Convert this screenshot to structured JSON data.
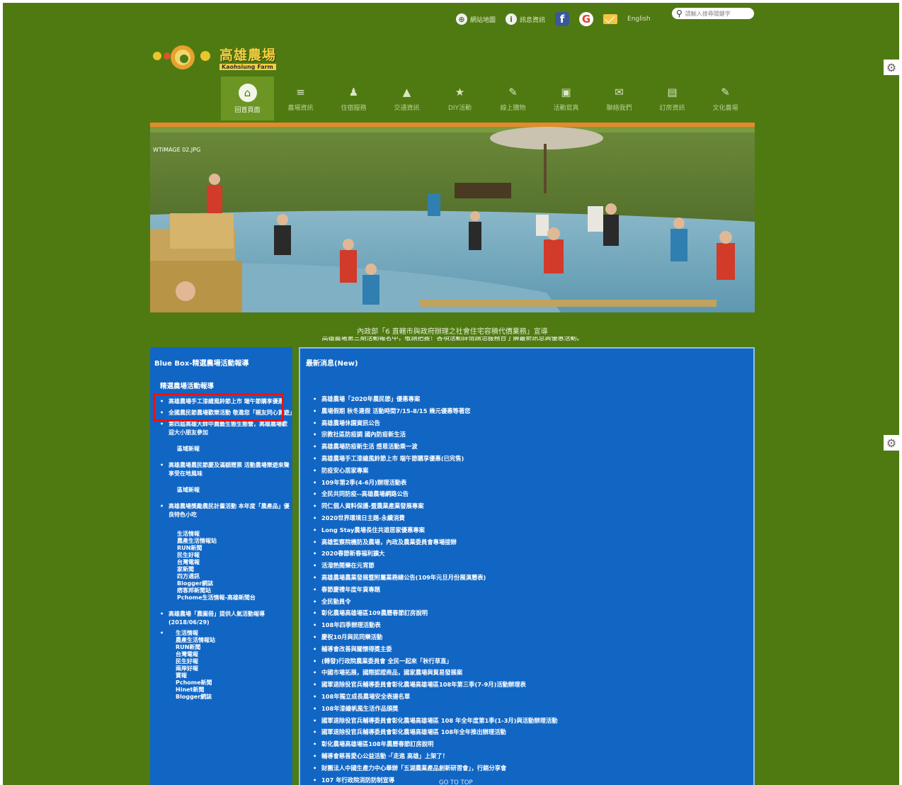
{
  "utility_bar": {
    "items": [
      {
        "icon": "sitemap-icon",
        "label": "網站地圖"
      },
      {
        "icon": "info-icon",
        "label": "訊息資訊"
      }
    ],
    "lang_label": "English",
    "search_placeholder": "請輸入搜尋關鍵字"
  },
  "logo": {
    "name_cn": "高雄農場",
    "name_en": "Kaohsiung Farm"
  },
  "nav": {
    "items": [
      {
        "label": "回首頁面",
        "icon": "home-icon",
        "glyph": "⌂"
      },
      {
        "label": "農場資訊",
        "icon": "list-icon",
        "glyph": "≡"
      },
      {
        "label": "住宿服務",
        "icon": "person-icon",
        "glyph": "♟"
      },
      {
        "label": "交通資訊",
        "icon": "mountain-icon",
        "glyph": "▲"
      },
      {
        "label": "DIY活動",
        "icon": "star-icon",
        "glyph": "★"
      },
      {
        "label": "線上購物",
        "icon": "edit-icon",
        "glyph": "✎"
      },
      {
        "label": "活動寫真",
        "icon": "image-icon",
        "glyph": "▣"
      },
      {
        "label": "聯絡我們",
        "icon": "mail-icon",
        "glyph": "✉"
      },
      {
        "label": "訂房資訊",
        "icon": "calendar-icon",
        "glyph": "▤"
      },
      {
        "label": "文化農場",
        "icon": "pencil-icon",
        "glyph": "✎"
      }
    ]
  },
  "banner": {
    "label": "WTIMAGE 02.JPG"
  },
  "marquee": {
    "text": "內政部「6 直轄市與政府辦理之社會住宅容積代價業務」宣導",
    "text2": "高雄農場第三期活動報名中，敬請把握！各項活動詳情請洽服務台了解最新訊息與優惠活動。"
  },
  "sidebar": {
    "title": "Blue Box-精選農場活動報導",
    "subtitle": "精選農場活動報導",
    "items": [
      "高雄農場手工漆繪風鈴節上市 端午節購享優惠",
      "全國農民節農場歡樂活動 敬邀您「親友同心賞遊」",
      "第四屆高雄大師中農藝生態生態營，高雄農場歡迎大小朋友參加",
      "區域新報",
      "高雄農場農民節慶及滿額贈票 活動農場樂遊來聲享受在地風味",
      "區域新報",
      "高雄農場獎勵農民計畫活動 本年度「農產品」優良特色小吃"
    ],
    "plain_block_1": [
      "生活情報",
      "農產生活情報站",
      "RUN新聞",
      "民生好報",
      "台灣電報",
      "家新聞",
      "四方通訊",
      "Blogger網誌",
      "痞客邦新聞站",
      "Pchome生活情報-高雄新聞台"
    ],
    "item_2018": "高雄農場「農圖冊」提供人氣活動報導 (2018/06/29)",
    "plain_block_2": [
      "生活情報",
      "農產生活情報站",
      "RUN新聞",
      "台灣電報",
      "民生好報",
      "兩岸好報",
      "寶報",
      "Pchome新聞",
      "Hinet新聞",
      "Blogger網誌"
    ]
  },
  "news": {
    "title": "最新消息(New)",
    "items": [
      "高雄農場「2020年農民節」優惠專案",
      "農場假期 秋冬連假 活動時間7/15-8/15 幾元優惠等著您",
      "高雄農場休園資訊公告",
      "宗教社區防疫調 國內防疫新生活",
      "高雄農場防疫新生活 感恩活動乘一波",
      "高雄農場手工漆繪風鈴節上市 端午節購享優惠(已完售)",
      "防疫安心居家專案",
      "109年第2季(4-6月)辦理活動表",
      "全民共同防疫--高雄農場網路公告",
      "同仁個人資料保護-暨農業產業發展專案",
      "2020世界環境日主題-永續消費",
      "Long Stay農場長住共遊居家優惠專案",
      "高雄監察院機防及農場，內政及農業委員會專場接辦",
      "2020春節新春福利擴大",
      "活潑熱鬧樂在元宵節",
      "高雄農場農業發展暨附屬業務總公告(109年元旦月份展演曆表)",
      "春節慶禮年度年貨專題",
      "全民動員令",
      "彰化農場高雄場區109農曆春節訂房說明",
      "108年四季辦理活動表",
      "慶祝10月與民同樂活動",
      "輔導會改善與關懷得獎主委",
      "(轉發)行政院農業委員會 全民一起來「秋行草直」",
      "中國市場拓展，國際認證商品，國家農場與貿易發展案",
      "國軍退除役官兵輔導委員會彰化農場高雄場區108年第三季(7-9月)活動辦理表",
      "108年獨立成長農場安全表揚名單",
      "108年漆繪帆風生活作品頒獎",
      "國軍退除役官兵輔導委員會彰化農場高雄場區 108 年全年度第1季(1-3月)與活動辦理活動",
      "國軍退除役官兵輔導委員會彰化農場高雄場區 108年全年推出辦理活動",
      "彰化農場高雄場區108年農曆春節訂房說明",
      "輔導會慈善愛心公益活動 ·「走進 高雄」上架了！",
      "財團法人中國生產力中心舉辦「五湖農業產品創新研習會」，行銷分享會",
      "107 年行政院消防防制宣導"
    ]
  },
  "go_to_top": "GO TO TOP"
}
